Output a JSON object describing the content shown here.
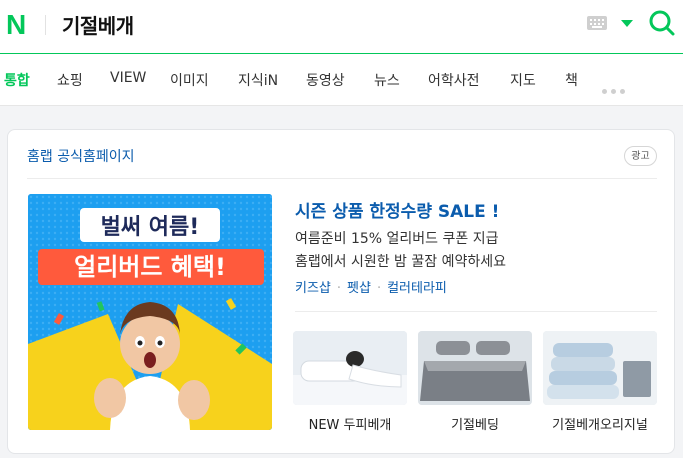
{
  "header": {
    "logo_text": "N",
    "query": "기절베개",
    "colors": {
      "brand": "#03c75a"
    }
  },
  "tabs": [
    {
      "label": "통합",
      "active": true
    },
    {
      "label": "쇼핑"
    },
    {
      "label": "VIEW"
    },
    {
      "label": "이미지"
    },
    {
      "label": "지식iN"
    },
    {
      "label": "동영상"
    },
    {
      "label": "뉴스"
    },
    {
      "label": "어학사전"
    },
    {
      "label": "지도"
    },
    {
      "label": "책"
    }
  ],
  "ad": {
    "brand": "홈랩 공식홈페이지",
    "badge": "광고",
    "banner_line1": "벌써 여름!",
    "banner_line2": "얼리버드 혜택!",
    "headline": "시즌 상품 한정수량 SALE !",
    "desc1": "여름준비 15% 얼리버드 쿠폰 지급",
    "desc2": "홈랩에서 시원한 밤 꿀잠 예약하세요",
    "links": [
      "키즈샵",
      "펫샵",
      "컬러테라피"
    ],
    "products": [
      {
        "label": "NEW 두피베개"
      },
      {
        "label": "기절베딩"
      },
      {
        "label": "기절베개오리지널"
      }
    ]
  }
}
